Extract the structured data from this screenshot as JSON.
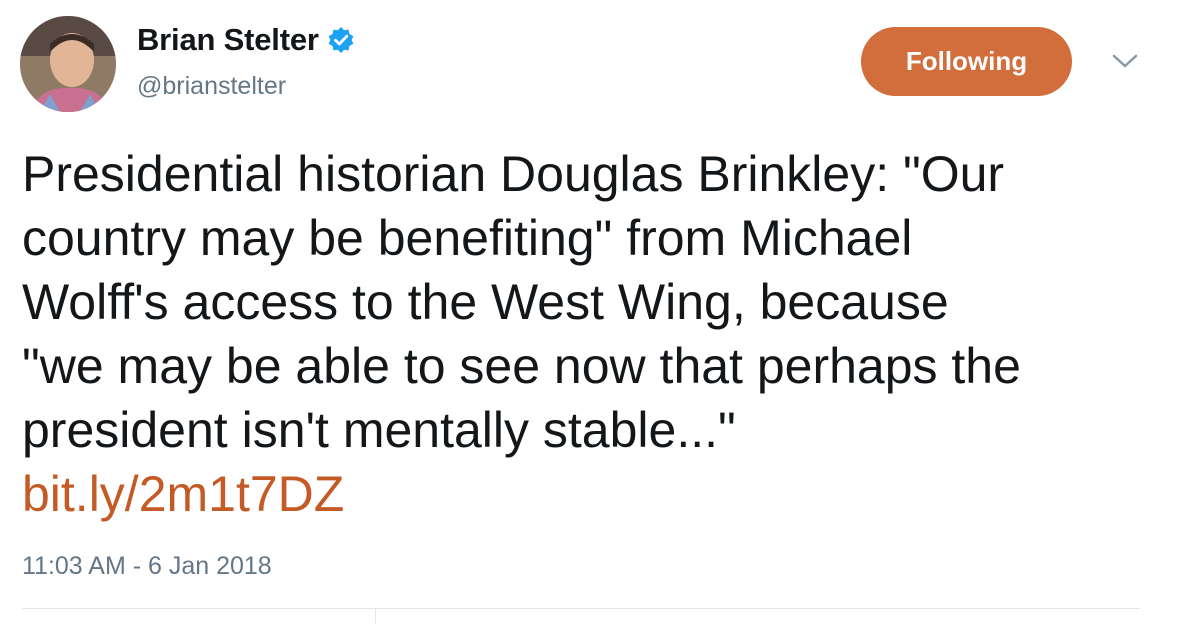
{
  "author": {
    "display_name": "Brian Stelter",
    "handle": "@brianstelter",
    "verified": true,
    "avatar_icon": "user-avatar"
  },
  "follow_button": {
    "label": "Following",
    "color": "#d26d3c"
  },
  "menu_icon": "chevron-down-icon",
  "tweet": {
    "lines": [
      "Presidential historian Douglas Brinkley: \"Our",
      "country may be benefiting\" from Michael",
      "Wolff's access to the West Wing, because",
      "\"we may be able to see now that perhaps the",
      "president isn't mentally stable...\""
    ],
    "link": "bit.ly/2m1t7DZ",
    "link_color": "#c45a26"
  },
  "timestamp": "11:03 AM - 6 Jan 2018"
}
